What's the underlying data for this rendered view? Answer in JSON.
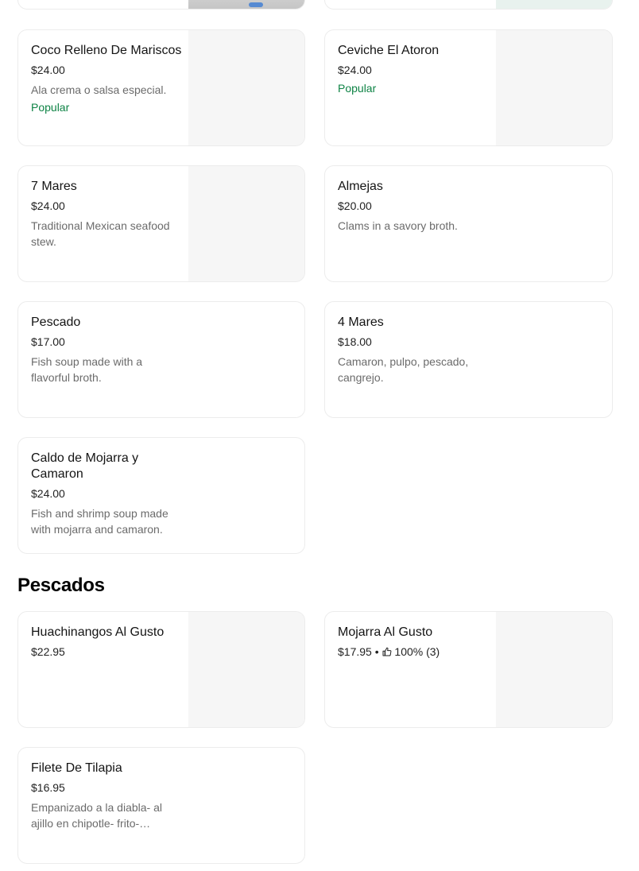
{
  "top_partial": {
    "left_thumb": "food-photo",
    "right_thumb": "food-photo"
  },
  "items": [
    {
      "name": "Coco Relleno De Mariscos",
      "price": "$24.00",
      "description": "Ala crema o salsa especial.",
      "badge": "Popular"
    },
    {
      "name": "Ceviche El Atoron",
      "price": "$24.00",
      "description": "",
      "badge": "Popular"
    },
    {
      "name": "7 Mares",
      "price": "$24.00",
      "description": "Traditional Mexican seafood stew.",
      "badge": ""
    },
    {
      "name": "Almejas",
      "price": "$20.00",
      "description": "Clams in a savory broth.",
      "badge": ""
    },
    {
      "name": "Pescado",
      "price": "$17.00",
      "description": "Fish soup made with a flavorful broth.",
      "badge": ""
    },
    {
      "name": "4 Mares",
      "price": "$18.00",
      "description": "Camaron, pulpo, pescado, cangrejo.",
      "badge": ""
    },
    {
      "name": "Caldo de Mojarra y Camaron",
      "price": "$24.00",
      "description": "Fish and shrimp soup made with mojarra and camaron.",
      "badge": ""
    }
  ],
  "sections": [
    {
      "title": "Pescados",
      "items": [
        {
          "name": "Huachinangos Al Gusto",
          "price": "$22.95"
        },
        {
          "name": "Mojarra Al Gusto",
          "price": "$17.95",
          "separator": "•",
          "rating": "100% (3)",
          "rating_icon": "thumbs-up-icon"
        },
        {
          "name": "Filete De Tilapia",
          "price": "$16.95",
          "description": "Empanizado a la diabla- al ajillo en chipotle- frito-…"
        }
      ]
    }
  ],
  "colors": {
    "popular": "#0e8345",
    "description": "#6b6b6b",
    "border": "#ececec",
    "thumb_placeholder": "#f6f6f6"
  }
}
